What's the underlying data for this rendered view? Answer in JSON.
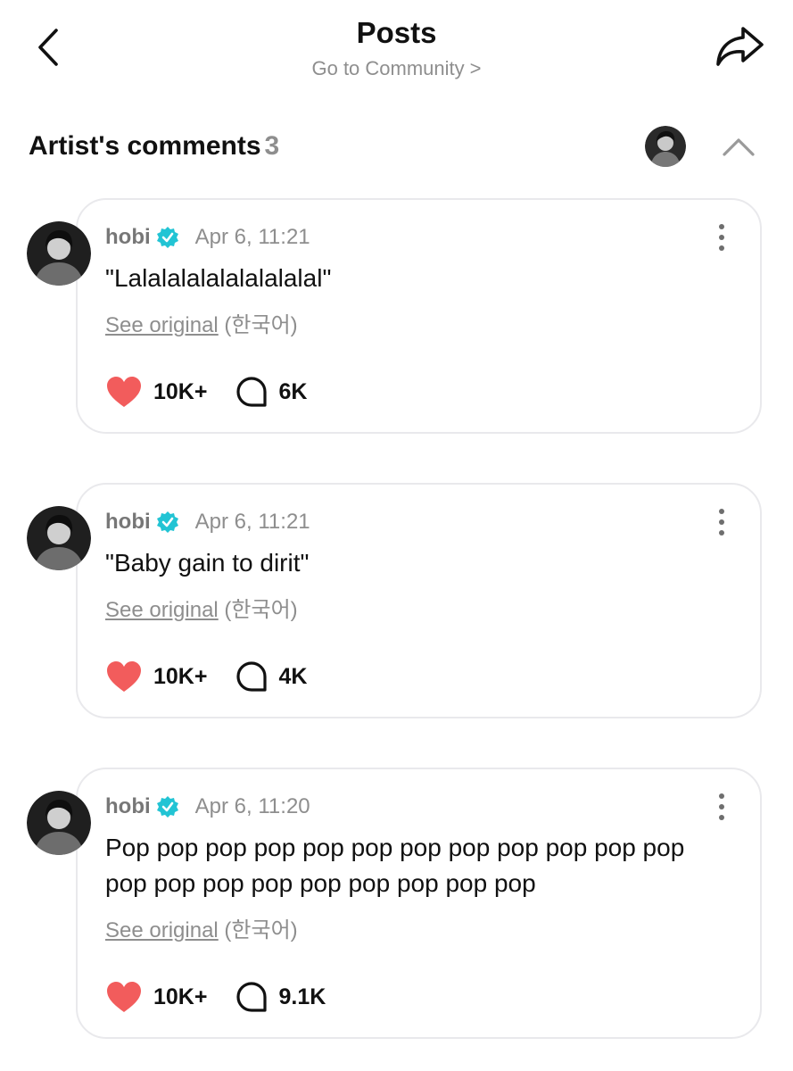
{
  "header": {
    "title": "Posts",
    "subtitle": "Go to Community",
    "subtitle_chevron": ">",
    "back_icon": "chevron-left-icon",
    "share_icon": "share-arrow-icon"
  },
  "section": {
    "title": "Artist's comments",
    "count": "3",
    "collapse_icon": "chevron-up-icon"
  },
  "colors": {
    "heart": "#f25c5c",
    "verified": "#22c4d4",
    "muted_text": "#8e8e8e",
    "card_border": "#e9e9ec"
  },
  "comments": [
    {
      "author": "hobi",
      "verified": true,
      "time": "Apr 6, 11:21",
      "text": "\"Lalalalalalalalalalal\"",
      "see_original": "See original",
      "original_lang": "(한국어)",
      "likes": "10K+",
      "replies": "6K"
    },
    {
      "author": "hobi",
      "verified": true,
      "time": "Apr 6, 11:21",
      "text": "\"Baby gain to dirit\"",
      "see_original": "See original",
      "original_lang": "(한국어)",
      "likes": "10K+",
      "replies": "4K"
    },
    {
      "author": "hobi",
      "verified": true,
      "time": "Apr 6, 11:20",
      "text": "Pop pop pop pop pop pop pop pop pop pop pop pop pop pop pop pop pop pop pop pop pop",
      "see_original": "See original",
      "original_lang": "(한국어)",
      "likes": "10K+",
      "replies": "9.1K"
    }
  ]
}
